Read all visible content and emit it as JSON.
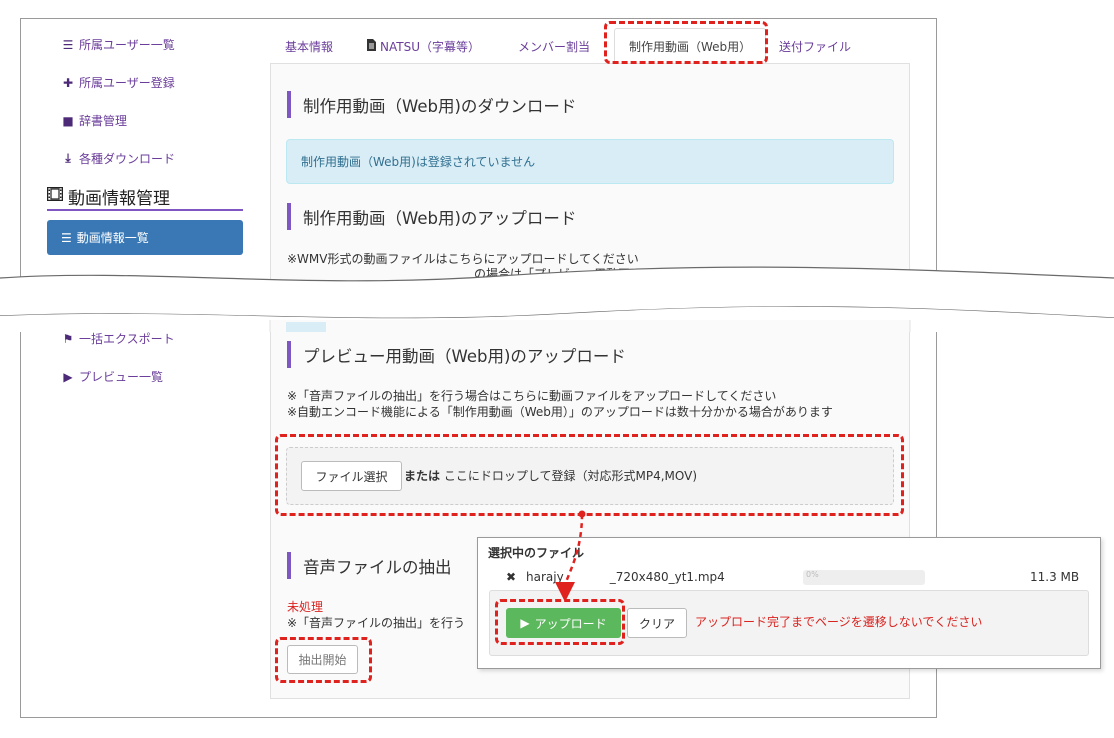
{
  "sidebar": {
    "items": [
      {
        "icon": "list-icon",
        "glyph": "☰",
        "label": "所属ユーザー一覧"
      },
      {
        "icon": "plus-icon",
        "glyph": "✚",
        "label": "所属ユーザー登録"
      },
      {
        "icon": "square-icon",
        "glyph": "■",
        "label": "辞書管理"
      },
      {
        "icon": "download-icon",
        "glyph": "⤓",
        "label": "各種ダウンロード"
      }
    ],
    "section_title": "動画情報管理",
    "section_icon": "film-icon",
    "active_item": "動画情報一覧",
    "lower_items": [
      {
        "icon": "flag-icon",
        "glyph": "⚑",
        "label": "一括エクスポート"
      },
      {
        "icon": "play-icon",
        "glyph": "▶",
        "label": "プレビュー一覧"
      }
    ]
  },
  "tabs": {
    "basic": "基本情報",
    "natsu": "NATSU（字幕等）",
    "members": "メンバー割当",
    "production": "制作用動画（Web用）",
    "send": "送付ファイル"
  },
  "main": {
    "download_title": "制作用動画（Web用)のダウンロード",
    "download_alert": "制作用動画（Web用)は登録されていません",
    "upload_title": "制作用動画（Web用)のアップロード",
    "upload_note1": "※WMV形式の動画ファイルはこちらにアップロードしてください",
    "upload_note2_partial": "の場合は「プレビュー用動画 (Web用)のアップロード」をご使用ください",
    "preview_title": "プレビュー用動画（Web用)のアップロード",
    "preview_note1": "※「音声ファイルの抽出」を行う場合はこちらに動画ファイルをアップロードしてください",
    "preview_note2": "※自動エンコード機能による「制作用動画（Web用）」のアップロードは数十分かかる場合があります",
    "file_select": "ファイル選択",
    "or_label": "または",
    "drop_text": "ここにドロップして登録（対応形式MP4,MOV)",
    "audio_title": "音声ファイルの抽出",
    "status_unprocessed": "未処理",
    "audio_note": "※「音声ファイルの抽出」を行う",
    "extract_button": "抽出開始"
  },
  "popup": {
    "heading": "選択中のファイル",
    "file_name_start": "harajy",
    "file_name_end": "_720x480_yt1.mp4",
    "progress_text": "0%",
    "file_size": "11.3 MB",
    "upload_button": "アップロード",
    "clear_button": "クリア",
    "warning": "アップロード完了までページを遷移しないでください"
  },
  "colors": {
    "accent_purple": "#7e57c2",
    "active_blue": "#3a78b5",
    "alert_bg": "#d9edf7",
    "success_green": "#5cb85c",
    "highlight_red": "#e0221f"
  }
}
